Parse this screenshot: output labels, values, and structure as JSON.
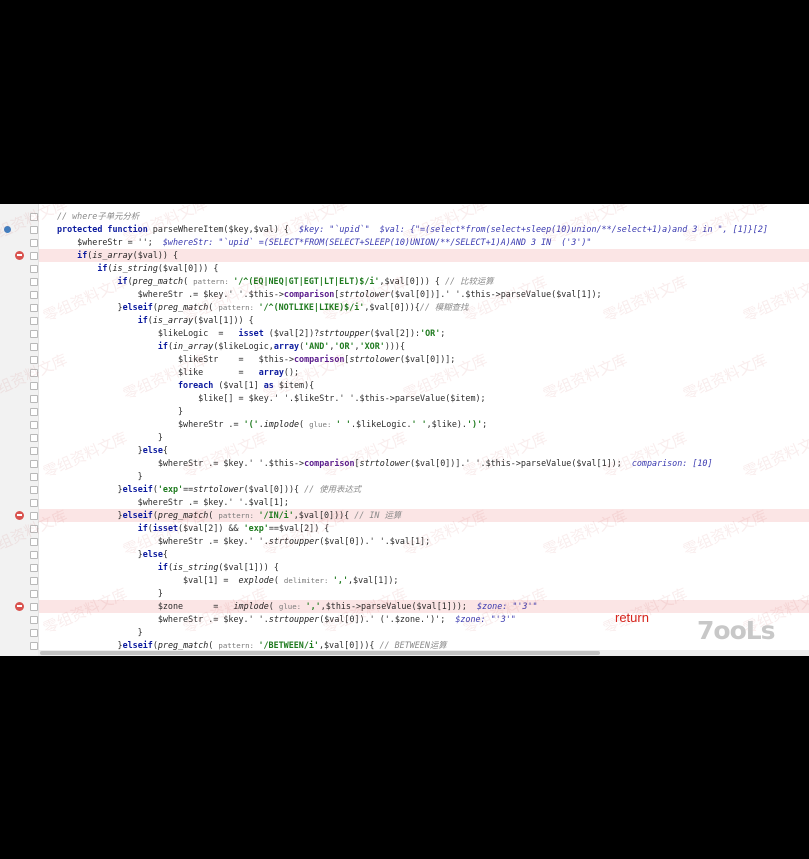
{
  "editor": {
    "lines": [
      {
        "segments": [
          {
            "t": "// where子单元分析",
            "c": "cm"
          }
        ]
      },
      {
        "segments": [
          {
            "t": "protected function",
            "c": "kw"
          },
          {
            "t": " parseWhereItem($key,$val) {  "
          },
          {
            "t": "$key: \"`upid`\"  $val: {\"=(select*from(select+sleep(10)union/**/select+1)a)and 3 in \", [1]}[2]",
            "c": "dbg"
          }
        ]
      },
      {
        "segments": [
          {
            "t": "    $whereStr = '';  "
          },
          {
            "t": "$whereStr: \"`upid` =(SELECT*FROM(SELECT+SLEEP(10)UNION/**/SELECT+1)A)AND 3 IN  ('3')\"",
            "c": "dbg"
          }
        ]
      },
      {
        "segments": [
          {
            "t": "    "
          },
          {
            "t": "if",
            "c": "kw"
          },
          {
            "t": "("
          },
          {
            "t": "is_array",
            "c": "fn"
          },
          {
            "t": "($val)) {"
          }
        ]
      },
      {
        "segments": [
          {
            "t": "        "
          },
          {
            "t": "if",
            "c": "kw"
          },
          {
            "t": "("
          },
          {
            "t": "is_string",
            "c": "fn"
          },
          {
            "t": "($val[0])) {"
          }
        ]
      },
      {
        "segments": [
          {
            "t": "            "
          },
          {
            "t": "if",
            "c": "kw"
          },
          {
            "t": "("
          },
          {
            "t": "preg_match",
            "c": "fn"
          },
          {
            "t": "( "
          },
          {
            "t": "pattern: ",
            "c": "hint"
          },
          {
            "t": "'/^(EQ|NEQ|GT|EGT|LT|ELT)$/i'",
            "c": "str"
          },
          {
            "t": ",$val[0])) { "
          },
          {
            "t": "// 比较运算",
            "c": "cm"
          }
        ]
      },
      {
        "segments": [
          {
            "t": "                $whereStr .= $key.' '.$this->"
          },
          {
            "t": "comparison",
            "c": "fld"
          },
          {
            "t": "["
          },
          {
            "t": "strtolower",
            "c": "fn"
          },
          {
            "t": "($val[0])].' '.$this->parseValue($val[1]);"
          }
        ]
      },
      {
        "segments": [
          {
            "t": "            }"
          },
          {
            "t": "elseif",
            "c": "kw"
          },
          {
            "t": "("
          },
          {
            "t": "preg_match",
            "c": "fn"
          },
          {
            "t": "( "
          },
          {
            "t": "pattern: ",
            "c": "hint"
          },
          {
            "t": "'/^(NOTLIKE|LIKE)$/i'",
            "c": "str"
          },
          {
            "t": ",$val[0])){"
          },
          {
            "t": "// 模糊查找",
            "c": "cm"
          }
        ]
      },
      {
        "segments": [
          {
            "t": "                "
          },
          {
            "t": "if",
            "c": "kw"
          },
          {
            "t": "("
          },
          {
            "t": "is_array",
            "c": "fn"
          },
          {
            "t": "($val[1])) {"
          }
        ]
      },
      {
        "segments": [
          {
            "t": "                    $likeLogic  =   "
          },
          {
            "t": "isset",
            "c": "kw"
          },
          {
            "t": " ($val[2])?"
          },
          {
            "t": "strtoupper",
            "c": "fn"
          },
          {
            "t": "($val[2]):"
          },
          {
            "t": "'OR'",
            "c": "str"
          },
          {
            "t": ";"
          }
        ]
      },
      {
        "segments": [
          {
            "t": "                    "
          },
          {
            "t": "if",
            "c": "kw"
          },
          {
            "t": "("
          },
          {
            "t": "in_array",
            "c": "fn"
          },
          {
            "t": "($likeLogic,"
          },
          {
            "t": "array",
            "c": "kw"
          },
          {
            "t": "("
          },
          {
            "t": "'AND'",
            "c": "str"
          },
          {
            "t": ","
          },
          {
            "t": "'OR'",
            "c": "str"
          },
          {
            "t": ","
          },
          {
            "t": "'XOR'",
            "c": "str"
          },
          {
            "t": "))){"
          }
        ]
      },
      {
        "segments": [
          {
            "t": "                        $likeStr    =   $this->"
          },
          {
            "t": "comparison",
            "c": "fld"
          },
          {
            "t": "["
          },
          {
            "t": "strtolower",
            "c": "fn"
          },
          {
            "t": "($val[0])];"
          }
        ]
      },
      {
        "segments": [
          {
            "t": "                        $like       =   "
          },
          {
            "t": "array",
            "c": "kw"
          },
          {
            "t": "();"
          }
        ]
      },
      {
        "segments": [
          {
            "t": "                        "
          },
          {
            "t": "foreach",
            "c": "kw"
          },
          {
            "t": " ($val[1] "
          },
          {
            "t": "as",
            "c": "kw"
          },
          {
            "t": " $item){"
          }
        ]
      },
      {
        "segments": [
          {
            "t": "                            $like[] = $key.' '.$likeStr.' '.$this->parseValue($item);"
          }
        ]
      },
      {
        "segments": [
          {
            "t": "                        }"
          }
        ]
      },
      {
        "segments": [
          {
            "t": "                        $whereStr .= "
          },
          {
            "t": "'('",
            "c": "str"
          },
          {
            "t": "."
          },
          {
            "t": "implode",
            "c": "fn"
          },
          {
            "t": "( "
          },
          {
            "t": "glue: ",
            "c": "hint"
          },
          {
            "t": "' '",
            "c": "str"
          },
          {
            "t": ".$likeLogic."
          },
          {
            "t": "' '",
            "c": "str"
          },
          {
            "t": ",$like)."
          },
          {
            "t": "')'",
            "c": "str"
          },
          {
            "t": ";"
          }
        ]
      },
      {
        "segments": [
          {
            "t": "                    }"
          }
        ]
      },
      {
        "segments": [
          {
            "t": "                }"
          },
          {
            "t": "else",
            "c": "kw"
          },
          {
            "t": "{"
          }
        ]
      },
      {
        "segments": [
          {
            "t": "                    $whereStr .= $key.' '.$this->"
          },
          {
            "t": "comparison",
            "c": "fld"
          },
          {
            "t": "["
          },
          {
            "t": "strtolower",
            "c": "fn"
          },
          {
            "t": "($val[0])].' '.$this->parseValue($val[1]);  "
          },
          {
            "t": "comparison: [10]",
            "c": "dbg"
          }
        ]
      },
      {
        "segments": [
          {
            "t": "                }"
          }
        ]
      },
      {
        "segments": [
          {
            "t": "            }"
          },
          {
            "t": "elseif",
            "c": "kw"
          },
          {
            "t": "("
          },
          {
            "t": "'exp'",
            "c": "str"
          },
          {
            "t": "=="
          },
          {
            "t": "strtolower",
            "c": "fn"
          },
          {
            "t": "($val[0])){ "
          },
          {
            "t": "// 使用表达式",
            "c": "cm"
          }
        ]
      },
      {
        "segments": [
          {
            "t": "                $whereStr .= $key.' '.$val[1];"
          }
        ]
      },
      {
        "segments": [
          {
            "t": "            }"
          },
          {
            "t": "elseif",
            "c": "kw"
          },
          {
            "t": "("
          },
          {
            "t": "preg_match",
            "c": "fn"
          },
          {
            "t": "( "
          },
          {
            "t": "pattern: ",
            "c": "hint"
          },
          {
            "t": "'/IN/i'",
            "c": "str"
          },
          {
            "t": ",$val[0])){ "
          },
          {
            "t": "// IN 运算",
            "c": "cm"
          }
        ]
      },
      {
        "segments": [
          {
            "t": "                "
          },
          {
            "t": "if",
            "c": "kw"
          },
          {
            "t": "("
          },
          {
            "t": "isset",
            "c": "kw"
          },
          {
            "t": "($val[2]) && "
          },
          {
            "t": "'exp'",
            "c": "str"
          },
          {
            "t": "==$val[2]) {"
          }
        ]
      },
      {
        "segments": [
          {
            "t": "                    $whereStr .= $key.' '."
          },
          {
            "t": "strtoupper",
            "c": "fn"
          },
          {
            "t": "($val[0]).' '.$val[1];"
          }
        ]
      },
      {
        "segments": [
          {
            "t": "                }"
          },
          {
            "t": "else",
            "c": "kw"
          },
          {
            "t": "{"
          }
        ]
      },
      {
        "segments": [
          {
            "t": "                    "
          },
          {
            "t": "if",
            "c": "kw"
          },
          {
            "t": "("
          },
          {
            "t": "is_string",
            "c": "fn"
          },
          {
            "t": "($val[1])) {"
          }
        ]
      },
      {
        "segments": [
          {
            "t": "                         $val[1] =  "
          },
          {
            "t": "explode",
            "c": "fn"
          },
          {
            "t": "( "
          },
          {
            "t": "delimiter: ",
            "c": "hint"
          },
          {
            "t": "','",
            "c": "str"
          },
          {
            "t": ",$val[1]);"
          }
        ]
      },
      {
        "segments": [
          {
            "t": "                    }"
          }
        ]
      },
      {
        "segments": [
          {
            "t": "                    $zone      =   "
          },
          {
            "t": "implode",
            "c": "fn"
          },
          {
            "t": "( "
          },
          {
            "t": "glue: ",
            "c": "hint"
          },
          {
            "t": "','",
            "c": "str"
          },
          {
            "t": ",$this->parseValue($val[1]));  "
          },
          {
            "t": "$zone: \"'3'\"",
            "c": "dbg"
          }
        ]
      },
      {
        "segments": [
          {
            "t": "                    $whereStr .= $key.' '."
          },
          {
            "t": "strtoupper",
            "c": "fn"
          },
          {
            "t": "($val[0]).' ('.$zone.')';  "
          },
          {
            "t": "$zone: \"'3'\"",
            "c": "dbg"
          }
        ]
      },
      {
        "segments": [
          {
            "t": "                }"
          }
        ]
      },
      {
        "segments": [
          {
            "t": "            }"
          },
          {
            "t": "elseif",
            "c": "kw"
          },
          {
            "t": "("
          },
          {
            "t": "preg_match",
            "c": "fn"
          },
          {
            "t": "( "
          },
          {
            "t": "pattern: ",
            "c": "hint"
          },
          {
            "t": "'/BETWEEN/i'",
            "c": "str"
          },
          {
            "t": ",$val[0])){ "
          },
          {
            "t": "// BETWEEN运算",
            "c": "cm"
          }
        ]
      }
    ],
    "highlighted_lines": [
      3,
      23,
      30
    ],
    "breakpoint_lines": [
      3,
      23,
      30
    ],
    "watermark_text": "零组资料文库",
    "return_label": "return",
    "logo_text": "7ooLs"
  }
}
